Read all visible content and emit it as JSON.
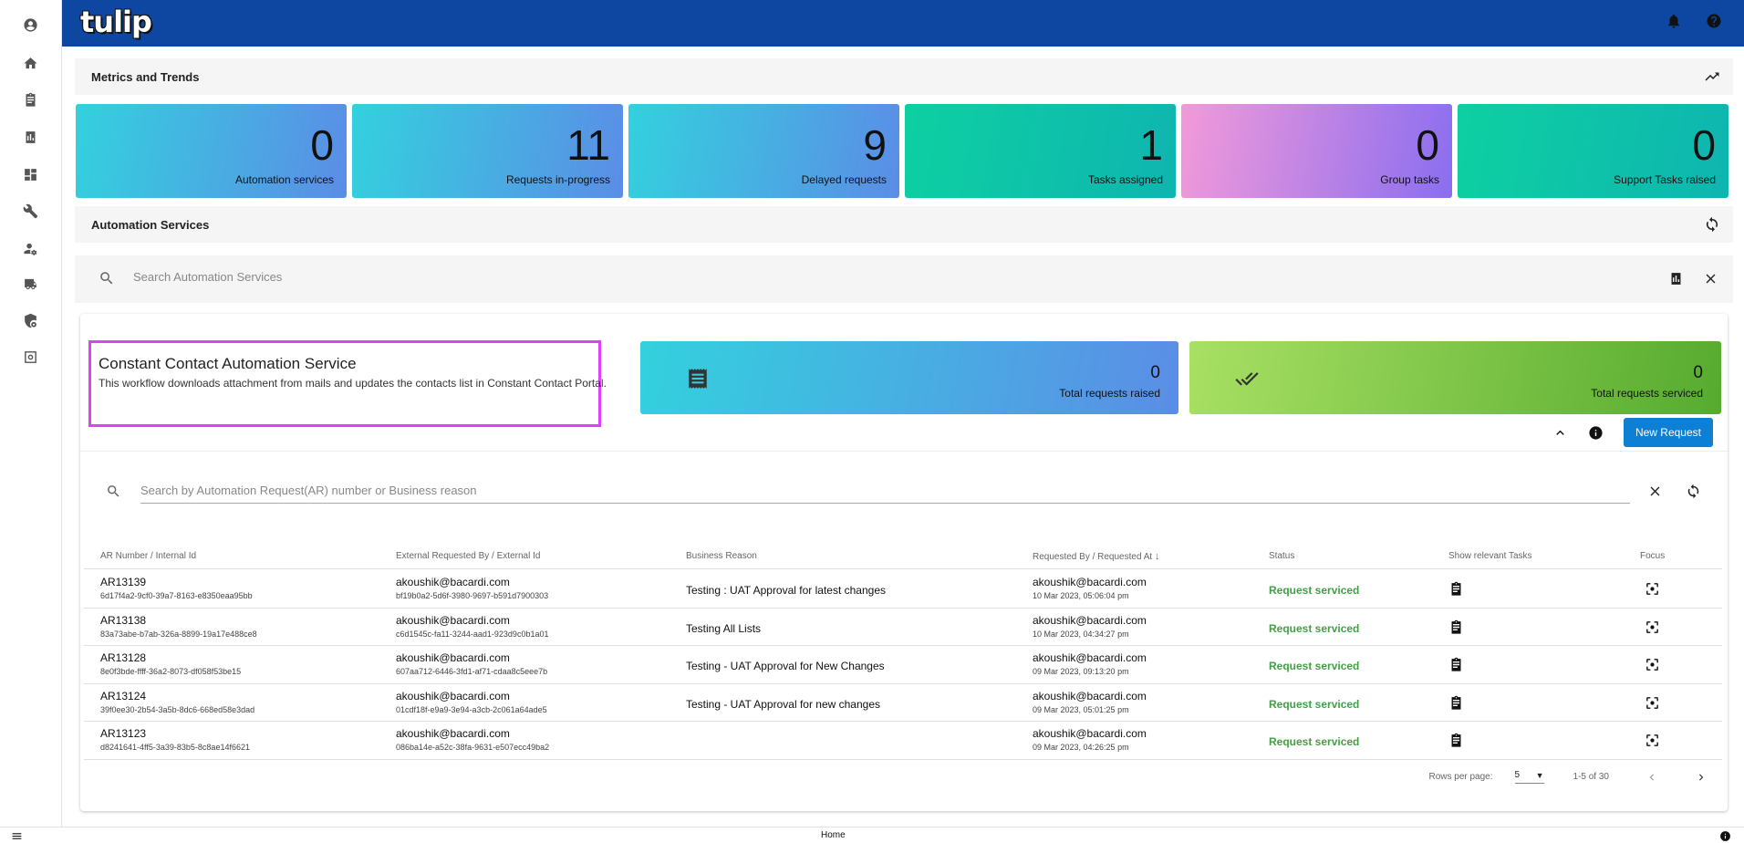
{
  "app": {
    "logo_text": "tulip"
  },
  "sidebar": {
    "items": [
      {
        "icon": "account-circle-icon"
      },
      {
        "icon": "home-icon"
      },
      {
        "icon": "clipboard-icon"
      },
      {
        "icon": "chart-icon"
      },
      {
        "icon": "dashboard-icon"
      },
      {
        "icon": "wrench-icon"
      },
      {
        "icon": "person-settings-icon"
      },
      {
        "icon": "truck-icon"
      },
      {
        "icon": "shield-settings-icon"
      },
      {
        "icon": "focus-box-icon"
      }
    ]
  },
  "header": {
    "icons": [
      "bell-icon",
      "help-icon"
    ]
  },
  "metrics_section": {
    "title": "Metrics and Trends",
    "icon": "trending-up-icon"
  },
  "metrics": [
    {
      "value": "0",
      "label": "Automation services",
      "gradient": [
        "#33d1de",
        "#5b8de6"
      ]
    },
    {
      "value": "11",
      "label": "Requests in-progress",
      "gradient": [
        "#33d1de",
        "#5b8de6"
      ]
    },
    {
      "value": "9",
      "label": "Delayed requests",
      "gradient": [
        "#33d1de",
        "#5b8de6"
      ]
    },
    {
      "value": "1",
      "label": "Tasks assigned",
      "gradient": [
        "#0dd0a2",
        "#0fb5b0"
      ]
    },
    {
      "value": "0",
      "label": "Group tasks",
      "gradient": [
        "#f29ad9",
        "#8a6ef0"
      ]
    },
    {
      "value": "0",
      "label": "Support Tasks raised",
      "gradient": [
        "#0dd0a2",
        "#0fb5b0"
      ]
    }
  ],
  "services_section": {
    "title": "Automation Services",
    "icon": "sync-icon"
  },
  "service_search": {
    "placeholder": "Search Automation Services"
  },
  "service": {
    "title": "Constant Contact Automation Service",
    "description": "This workflow downloads attachment from mails and updates the contacts list in Constant Contact Portal.",
    "stats": [
      {
        "value": "0",
        "label": "Total requests raised",
        "icon": "receipt-icon",
        "gradient": [
          "#33d1de",
          "#5b8de6"
        ]
      },
      {
        "value": "0",
        "label": "Total requests serviced",
        "icon": "double-check-icon",
        "gradient": [
          "#a8e063",
          "#56ab2f"
        ]
      }
    ],
    "new_request_label": "New Request"
  },
  "request_search": {
    "placeholder": "Search by Automation Request(AR) number or Business reason"
  },
  "table": {
    "headers": {
      "ar": "AR Number / Internal Id",
      "external": "External Requested By / External Id",
      "reason": "Business Reason",
      "requested": "Requested By / Requested At",
      "status": "Status",
      "tasks": "Show relevant Tasks",
      "focus": "Focus"
    },
    "rows": [
      {
        "ar": "AR13139",
        "internal_id": "6d17f4a2-9cf0-39a7-8163-e8350eaa95bb",
        "ext_by": "akoushik@bacardi.com",
        "ext_id": "bf19b0a2-5d6f-3980-9697-b591d7900303",
        "reason": "Testing : UAT Approval for latest changes",
        "req_by": "akoushik@bacardi.com",
        "req_at": "10 Mar 2023, 05:06:04 pm",
        "status": "Request serviced"
      },
      {
        "ar": "AR13138",
        "internal_id": "83a73abe-b7ab-326a-8899-19a17e488ce8",
        "ext_by": "akoushik@bacardi.com",
        "ext_id": "c6d1545c-fa11-3244-aad1-923d9c0b1a01",
        "reason": "Testing All Lists",
        "req_by": "akoushik@bacardi.com",
        "req_at": "10 Mar 2023, 04:34:27 pm",
        "status": "Request serviced"
      },
      {
        "ar": "AR13128",
        "internal_id": "8e0f3bde-ffff-36a2-8073-df058f53be15",
        "ext_by": "akoushik@bacardi.com",
        "ext_id": "607aa712-6446-3fd1-af71-cdaa8c5eee7b",
        "reason": "Testing - UAT Approval for New Changes",
        "req_by": "akoushik@bacardi.com",
        "req_at": "09 Mar 2023, 09:13:20 pm",
        "status": "Request serviced"
      },
      {
        "ar": "AR13124",
        "internal_id": "39f0ee30-2b54-3a5b-8dc6-668ed58e3dad",
        "ext_by": "akoushik@bacardi.com",
        "ext_id": "01cdf18f-e9a9-3e94-a3cb-2c061a64ade5",
        "reason": "Testing - UAT Approval for new changes",
        "req_by": "akoushik@bacardi.com",
        "req_at": "09 Mar 2023, 05:01:25 pm",
        "status": "Request serviced"
      },
      {
        "ar": "AR13123",
        "internal_id": "d8241641-4ff5-3a39-83b5-8c8ae14f6621",
        "ext_by": "akoushik@bacardi.com",
        "ext_id": "086ba14e-a52c-38fa-9631-e507ecc49ba2",
        "reason": "",
        "req_by": "akoushik@bacardi.com",
        "req_at": "09 Mar 2023, 04:26:25 pm",
        "status": "Request serviced"
      }
    ]
  },
  "pagination": {
    "rows_label": "Rows per page:",
    "rows_value": "5",
    "range": "1-5 of 30"
  },
  "footer": {
    "label": "Home"
  },
  "colors": {
    "header": "#0d47a1",
    "status_green": "#43a047",
    "highlight": "#e040fb",
    "button_blue": "#0d7fd4"
  }
}
